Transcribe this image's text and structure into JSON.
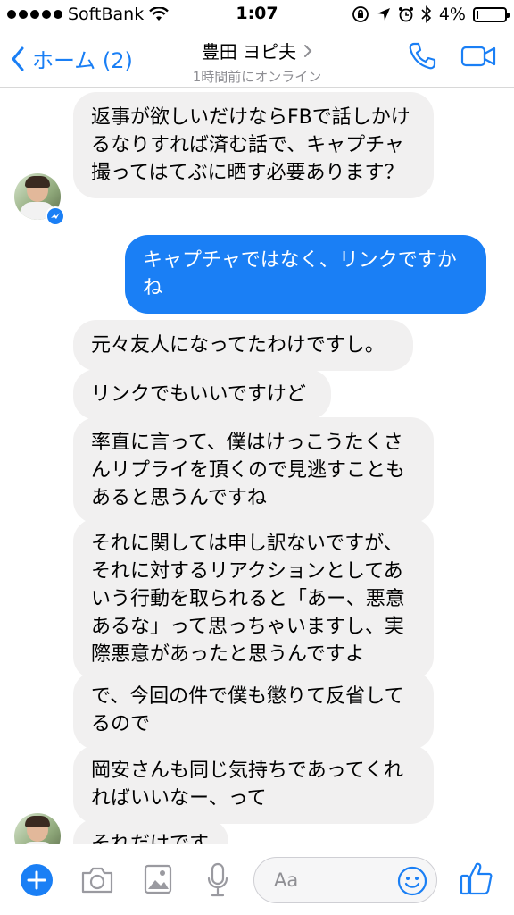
{
  "status_bar": {
    "carrier": "SoftBank",
    "time": "1:07",
    "battery_percent_label": "4%",
    "battery_level": 0.04
  },
  "nav": {
    "back_label": "ホーム (2)",
    "contact_name": "豊田 ヨピ夫",
    "contact_status": "1時間前にオンライン",
    "icons": [
      "chevron-left-icon",
      "chevron-right-icon",
      "phone-icon",
      "video-camera-icon"
    ]
  },
  "messages": [
    {
      "side": "in",
      "text": "返事が欲しいだけならFBで話しかけるなりすれば済む話で、キャプチャ撮ってはてぶに晒す必要あります？"
    },
    {
      "side": "out",
      "text": "キャプチャではなく、リンクですかね"
    },
    {
      "side": "in",
      "text": "元々友人になってたわけですし。"
    },
    {
      "side": "in",
      "text": "リンクでもいいですけど"
    },
    {
      "side": "in",
      "text": "率直に言って、僕はけっこうたくさんリプライを頂くので見逃すこともあると思うんですね"
    },
    {
      "side": "in",
      "text": "それに関しては申し訳ないですが、それに対するリアクションとしてあいう行動を取られると「あー、悪意あるな」って思っちゃいますし、実際悪意があったと思うんですよ"
    },
    {
      "side": "in",
      "text": "で、今回の件で僕も懲りて反省してるので"
    },
    {
      "side": "in",
      "text": "岡安さんも同じ気持ちであってくれればいいなー、って"
    },
    {
      "side": "in",
      "text": "それだけです"
    }
  ],
  "composer": {
    "placeholder": "Aa",
    "icons": [
      "plus-icon",
      "camera-icon",
      "image-icon",
      "microphone-icon",
      "emoji-icon",
      "thumbs-up-icon"
    ]
  },
  "colors": {
    "accent": "#1a7ff5",
    "incoming_bubble": "#f1f0f0",
    "secondary_text": "#8e8e93"
  }
}
